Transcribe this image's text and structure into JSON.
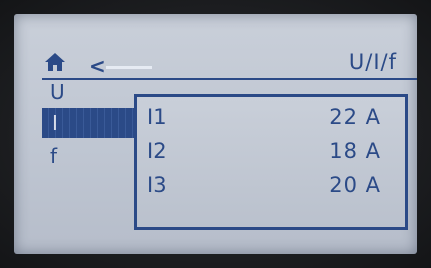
{
  "header": {
    "title": "U/I/f",
    "home_icon": "home-icon",
    "back_icon": "chevron-left-icon"
  },
  "menu": {
    "items": [
      {
        "label": "U"
      },
      {
        "label": "I"
      },
      {
        "label": "f"
      }
    ],
    "selected": "I"
  },
  "popup": {
    "rows": [
      {
        "label": "I1",
        "value": "22 A"
      },
      {
        "label": "I2",
        "value": "18 A"
      },
      {
        "label": "I3",
        "value": "20 A"
      }
    ]
  },
  "colors": {
    "ink": "#2b4a87",
    "screen": "#c3cad6"
  }
}
